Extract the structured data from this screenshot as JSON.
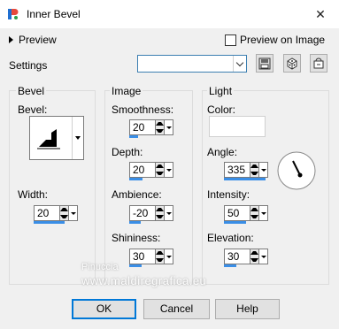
{
  "window": {
    "title": "Inner Bevel",
    "close_glyph": "✕"
  },
  "preview": {
    "label": "Preview",
    "on_image_label": "Preview on Image",
    "on_image_checked": false
  },
  "settings": {
    "label": "Settings",
    "value": ""
  },
  "bevel": {
    "group_label": "Bevel",
    "bevel_label": "Bevel:",
    "width_label": "Width:",
    "width_value": "20"
  },
  "image": {
    "group_label": "Image",
    "smoothness_label": "Smoothness:",
    "smoothness_value": "20",
    "depth_label": "Depth:",
    "depth_value": "20",
    "ambience_label": "Ambience:",
    "ambience_value": "-20",
    "shininess_label": "Shininess:",
    "shininess_value": "30"
  },
  "light": {
    "group_label": "Light",
    "color_label": "Color:",
    "color_value": "#ffffff",
    "angle_label": "Angle:",
    "angle_value": "335",
    "intensity_label": "Intensity:",
    "intensity_value": "50",
    "elevation_label": "Elevation:",
    "elevation_value": "30"
  },
  "buttons": {
    "ok": "OK",
    "cancel": "Cancel",
    "help": "Help"
  },
  "watermark": {
    "name": "Pinuccia",
    "site": "www.maldiregrafica.eu"
  },
  "icons": [
    "app-icon",
    "save-icon",
    "randomize-icon",
    "reset-icon",
    "close-icon",
    "chevron-down-icon"
  ]
}
